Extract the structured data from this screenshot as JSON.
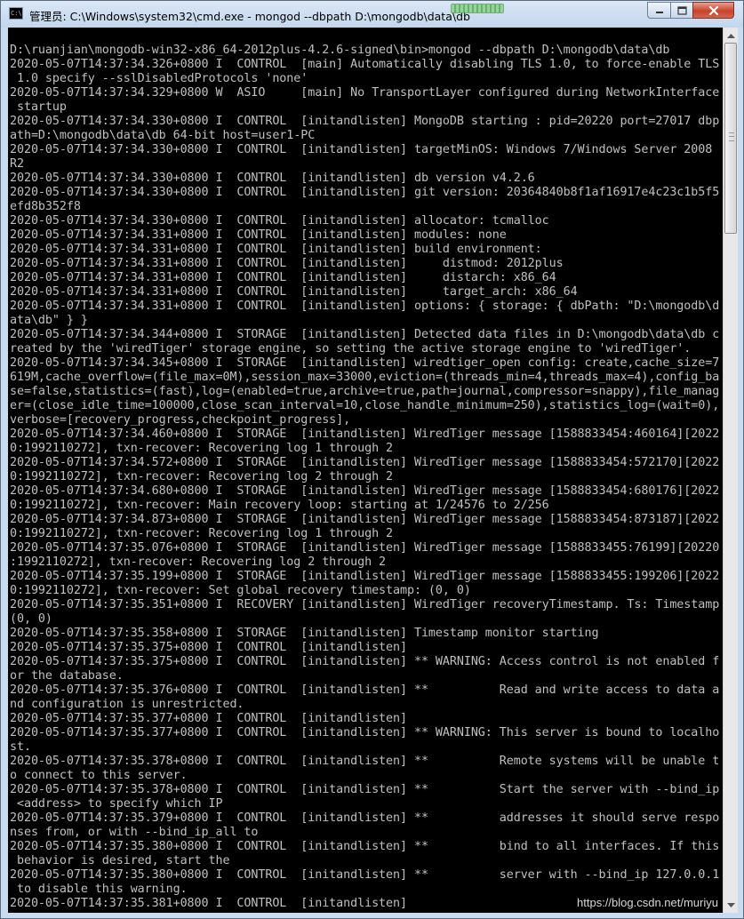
{
  "window": {
    "title": "管理员: C:\\Windows\\system32\\cmd.exe - mongod  --dbpath D:\\mongodb\\data\\db",
    "icon_label": "C:\\",
    "icon": "cmd-icon"
  },
  "caption_buttons": {
    "minimize_icon": "minimize-icon",
    "maximize_icon": "maximize-icon",
    "close_icon": "close-icon"
  },
  "console": {
    "lines": [
      "D:\\ruanjian\\mongodb-win32-x86_64-2012plus-4.2.6-signed\\bin>mongod --dbpath D:\\mongodb\\data\\db",
      "2020-05-07T14:37:34.326+0800 I  CONTROL  [main] Automatically disabling TLS 1.0, to force-enable TLS",
      " 1.0 specify --sslDisabledProtocols 'none'",
      "2020-05-07T14:37:34.329+0800 W  ASIO     [main] No TransportLayer configured during NetworkInterface",
      " startup",
      "2020-05-07T14:37:34.330+0800 I  CONTROL  [initandlisten] MongoDB starting : pid=20220 port=27017 dbp",
      "ath=D:\\mongodb\\data\\db 64-bit host=user1-PC",
      "2020-05-07T14:37:34.330+0800 I  CONTROL  [initandlisten] targetMinOS: Windows 7/Windows Server 2008",
      "R2",
      "2020-05-07T14:37:34.330+0800 I  CONTROL  [initandlisten] db version v4.2.6",
      "2020-05-07T14:37:34.330+0800 I  CONTROL  [initandlisten] git version: 20364840b8f1af16917e4c23c1b5f5",
      "efd8b352f8",
      "2020-05-07T14:37:34.330+0800 I  CONTROL  [initandlisten] allocator: tcmalloc",
      "2020-05-07T14:37:34.331+0800 I  CONTROL  [initandlisten] modules: none",
      "2020-05-07T14:37:34.331+0800 I  CONTROL  [initandlisten] build environment:",
      "2020-05-07T14:37:34.331+0800 I  CONTROL  [initandlisten]     distmod: 2012plus",
      "2020-05-07T14:37:34.331+0800 I  CONTROL  [initandlisten]     distarch: x86_64",
      "2020-05-07T14:37:34.331+0800 I  CONTROL  [initandlisten]     target_arch: x86_64",
      "2020-05-07T14:37:34.331+0800 I  CONTROL  [initandlisten] options: { storage: { dbPath: \"D:\\mongodb\\d",
      "ata\\db\" } }",
      "2020-05-07T14:37:34.344+0800 I  STORAGE  [initandlisten] Detected data files in D:\\mongodb\\data\\db c",
      "reated by the 'wiredTiger' storage engine, so setting the active storage engine to 'wiredTiger'.",
      "2020-05-07T14:37:34.345+0800 I  STORAGE  [initandlisten] wiredtiger_open config: create,cache_size=7",
      "619M,cache_overflow=(file_max=0M),session_max=33000,eviction=(threads_min=4,threads_max=4),config_ba",
      "se=false,statistics=(fast),log=(enabled=true,archive=true,path=journal,compressor=snappy),file_manag",
      "er=(close_idle_time=100000,close_scan_interval=10,close_handle_minimum=250),statistics_log=(wait=0),",
      "verbose=[recovery_progress,checkpoint_progress],",
      "2020-05-07T14:37:34.460+0800 I  STORAGE  [initandlisten] WiredTiger message [1588833454:460164][2022",
      "0:1992110272], txn-recover: Recovering log 1 through 2",
      "2020-05-07T14:37:34.572+0800 I  STORAGE  [initandlisten] WiredTiger message [1588833454:572170][2022",
      "0:1992110272], txn-recover: Recovering log 2 through 2",
      "2020-05-07T14:37:34.680+0800 I  STORAGE  [initandlisten] WiredTiger message [1588833454:680176][2022",
      "0:1992110272], txn-recover: Main recovery loop: starting at 1/24576 to 2/256",
      "2020-05-07T14:37:34.873+0800 I  STORAGE  [initandlisten] WiredTiger message [1588833454:873187][2022",
      "0:1992110272], txn-recover: Recovering log 1 through 2",
      "2020-05-07T14:37:35.076+0800 I  STORAGE  [initandlisten] WiredTiger message [1588833455:76199][20220",
      ":1992110272], txn-recover: Recovering log 2 through 2",
      "2020-05-07T14:37:35.199+0800 I  STORAGE  [initandlisten] WiredTiger message [1588833455:199206][2022",
      "0:1992110272], txn-recover: Set global recovery timestamp: (0, 0)",
      "2020-05-07T14:37:35.351+0800 I  RECOVERY [initandlisten] WiredTiger recoveryTimestamp. Ts: Timestamp",
      "(0, 0)",
      "2020-05-07T14:37:35.358+0800 I  STORAGE  [initandlisten] Timestamp monitor starting",
      "2020-05-07T14:37:35.375+0800 I  CONTROL  [initandlisten]",
      "2020-05-07T14:37:35.375+0800 I  CONTROL  [initandlisten] ** WARNING: Access control is not enabled f",
      "or the database.",
      "2020-05-07T14:37:35.376+0800 I  CONTROL  [initandlisten] **          Read and write access to data a",
      "nd configuration is unrestricted.",
      "2020-05-07T14:37:35.377+0800 I  CONTROL  [initandlisten]",
      "2020-05-07T14:37:35.377+0800 I  CONTROL  [initandlisten] ** WARNING: This server is bound to localho",
      "st.",
      "2020-05-07T14:37:35.378+0800 I  CONTROL  [initandlisten] **          Remote systems will be unable t",
      "o connect to this server.",
      "2020-05-07T14:37:35.378+0800 I  CONTROL  [initandlisten] **          Start the server with --bind_ip",
      " <address> to specify which IP",
      "2020-05-07T14:37:35.379+0800 I  CONTROL  [initandlisten] **          addresses it should serve respo",
      "nses from, or with --bind_ip_all to",
      "2020-05-07T14:37:35.380+0800 I  CONTROL  [initandlisten] **          bind to all interfaces. If this",
      " behavior is desired, start the",
      "2020-05-07T14:37:35.380+0800 I  CONTROL  [initandlisten] **          server with --bind_ip 127.0.0.1",
      " to disable this warning.",
      "2020-05-07T14:37:35.381+0800 I  CONTROL  [initandlisten]"
    ]
  },
  "scrollbar": {
    "up_icon": "scroll-up-arrow-icon",
    "down_icon": "scroll-down-arrow-icon"
  },
  "watermark": {
    "text": "https://blog.csdn.net/muriyu"
  }
}
